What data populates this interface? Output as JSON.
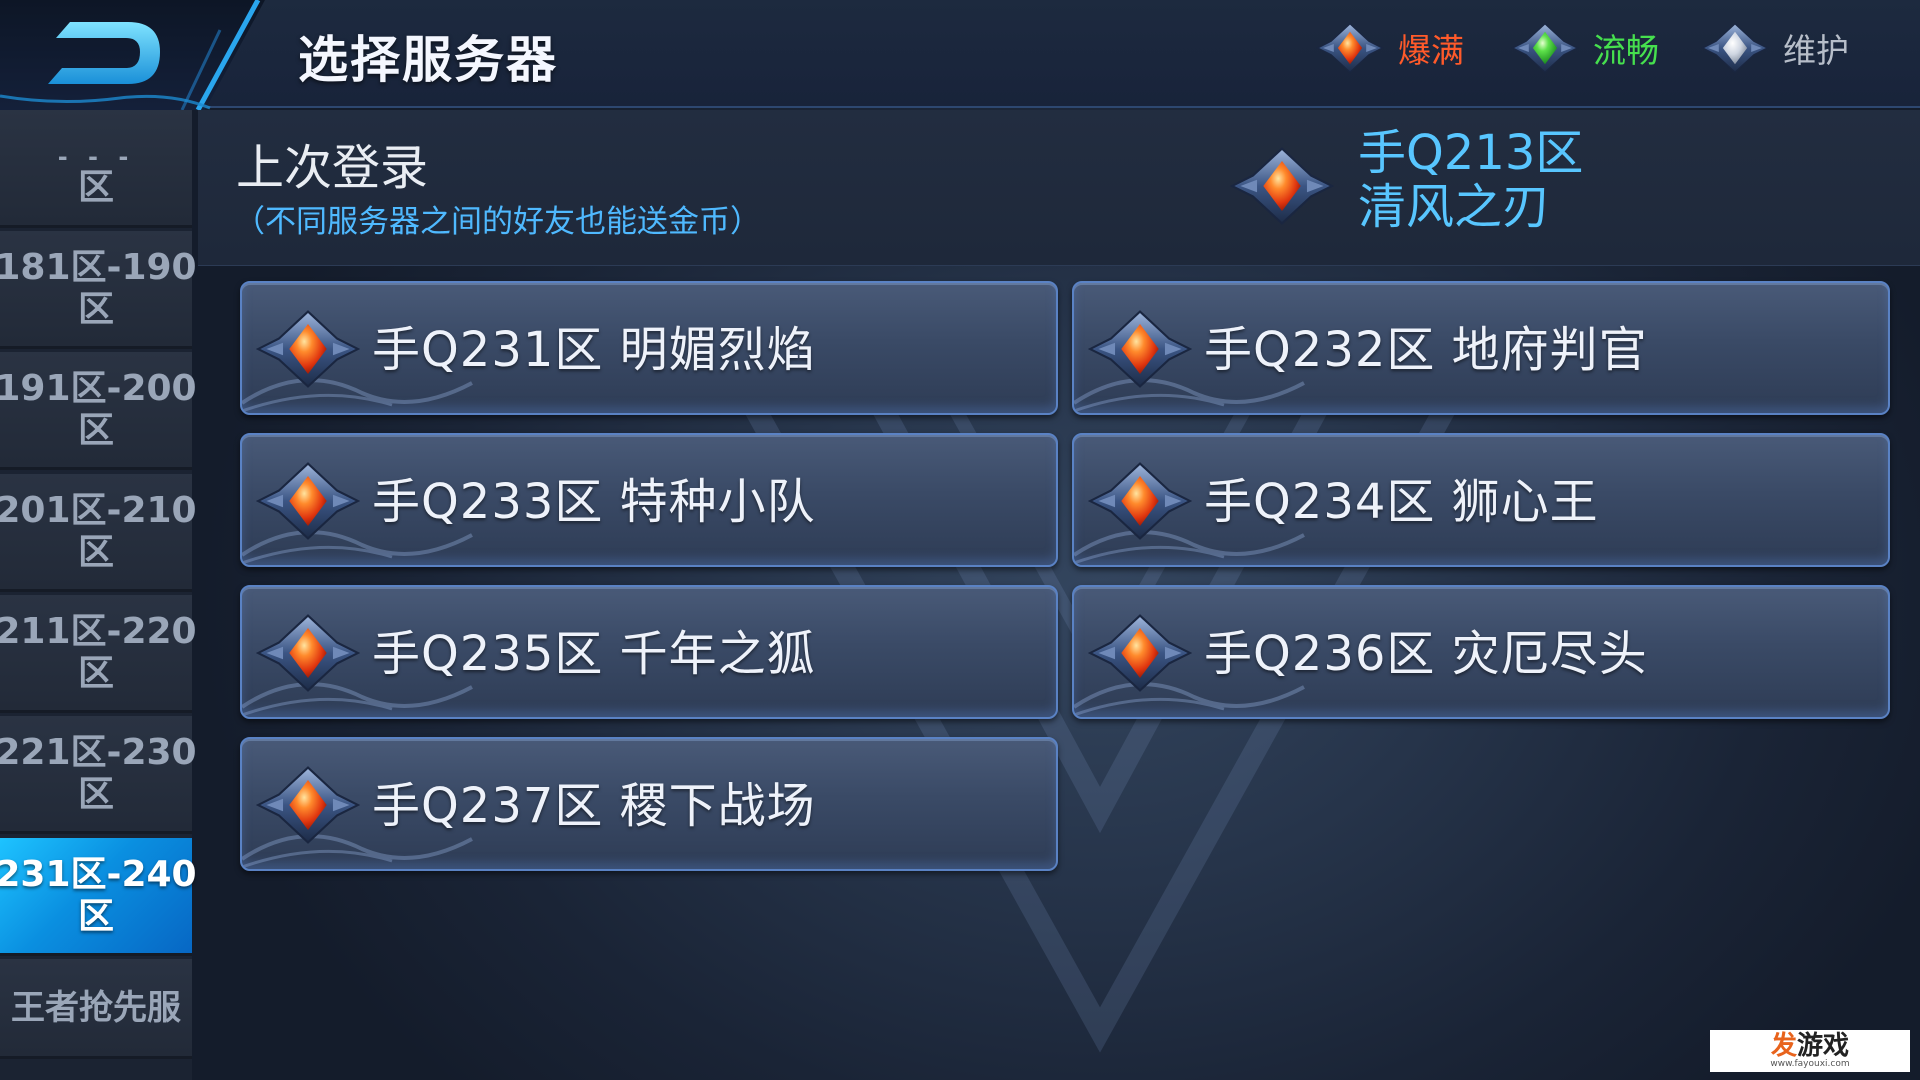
{
  "header": {
    "title": "选择服务器",
    "legend": [
      {
        "label": "爆满",
        "status": "full",
        "color": "#ff5a2a"
      },
      {
        "label": "流畅",
        "status": "smooth",
        "color": "#46e04e"
      },
      {
        "label": "维护",
        "status": "maintenance",
        "color": "#b7bec9"
      }
    ]
  },
  "sidebar": {
    "items": [
      {
        "line1": "- - -",
        "line2": "区"
      },
      {
        "line1": "181区-190",
        "line2": "区"
      },
      {
        "line1": "191区-200",
        "line2": "区"
      },
      {
        "line1": "201区-210",
        "line2": "区"
      },
      {
        "line1": "211区-220",
        "line2": "区"
      },
      {
        "line1": "221区-230",
        "line2": "区"
      },
      {
        "line1": "231区-240",
        "line2": "区",
        "active": true
      },
      {
        "line1": "王者抢先服",
        "line2": ""
      }
    ]
  },
  "last_login": {
    "title": "上次登录",
    "note": "（不同服务器之间的好友也能送金币）",
    "server_id": "手Q213区",
    "server_name": "清风之刃",
    "status": "full"
  },
  "servers": [
    {
      "label": "手Q231区 明媚烈焰",
      "status": "full"
    },
    {
      "label": "手Q232区 地府判官",
      "status": "full"
    },
    {
      "label": "手Q233区 特种小队",
      "status": "full"
    },
    {
      "label": "手Q234区 狮心王",
      "status": "full"
    },
    {
      "label": "手Q235区 千年之狐",
      "status": "full"
    },
    {
      "label": "手Q236区 灾厄尽头",
      "status": "full"
    },
    {
      "label": "手Q237区 稷下战场",
      "status": "full"
    }
  ],
  "watermark": {
    "logo_accent": "发",
    "logo_rest": "游戏",
    "url": "www.fayouxi.com"
  },
  "icons": {
    "back": "back-arrow-icon",
    "full": "red-diamond-gem-icon",
    "smooth": "green-diamond-gem-icon",
    "maintenance": "white-diamond-gem-icon"
  }
}
